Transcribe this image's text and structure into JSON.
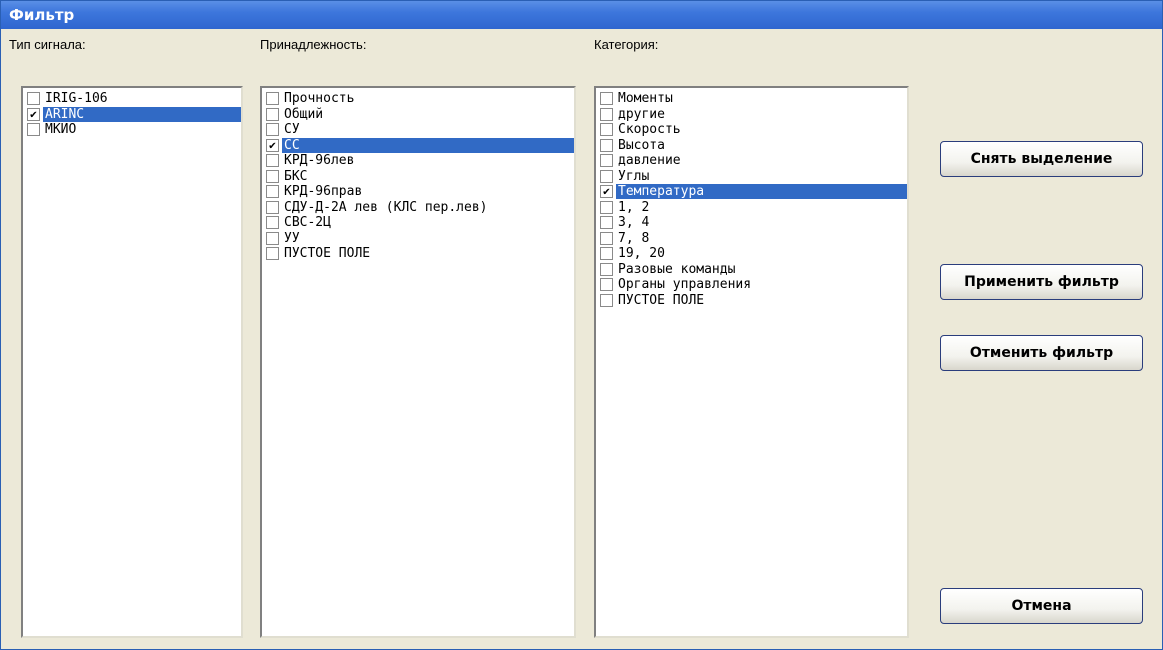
{
  "window": {
    "title": "Фильтр"
  },
  "signal_type": {
    "label": "Тип сигнала:",
    "items": [
      {
        "text": "IRIG-106",
        "checked": false,
        "selected": false
      },
      {
        "text": "ARINC",
        "checked": true,
        "selected": true
      },
      {
        "text": "МКИО",
        "checked": false,
        "selected": false
      }
    ]
  },
  "affiliation": {
    "label": "Принадлежность:",
    "items": [
      {
        "text": "Прочность",
        "checked": false,
        "selected": false
      },
      {
        "text": "Общий",
        "checked": false,
        "selected": false
      },
      {
        "text": "СУ",
        "checked": false,
        "selected": false
      },
      {
        "text": "СС",
        "checked": true,
        "selected": true
      },
      {
        "text": "КРД-96лев",
        "checked": false,
        "selected": false
      },
      {
        "text": "БКС",
        "checked": false,
        "selected": false
      },
      {
        "text": "КРД-96прав",
        "checked": false,
        "selected": false
      },
      {
        "text": "СДУ-Д-2А лев (КЛС пер.лев)",
        "checked": false,
        "selected": false
      },
      {
        "text": "СВС-2Ц",
        "checked": false,
        "selected": false
      },
      {
        "text": "УУ",
        "checked": false,
        "selected": false
      },
      {
        "text": "ПУСТОЕ ПОЛЕ",
        "checked": false,
        "selected": false
      }
    ]
  },
  "category": {
    "label": "Категория:",
    "items": [
      {
        "text": "Моменты",
        "checked": false,
        "selected": false
      },
      {
        "text": "другие",
        "checked": false,
        "selected": false
      },
      {
        "text": "Скорость",
        "checked": false,
        "selected": false
      },
      {
        "text": "Высота",
        "checked": false,
        "selected": false
      },
      {
        "text": "давление",
        "checked": false,
        "selected": false
      },
      {
        "text": "Углы",
        "checked": false,
        "selected": false
      },
      {
        "text": "Температура",
        "checked": true,
        "selected": true
      },
      {
        "text": "1, 2",
        "checked": false,
        "selected": false
      },
      {
        "text": "3, 4",
        "checked": false,
        "selected": false
      },
      {
        "text": "7, 8",
        "checked": false,
        "selected": false
      },
      {
        "text": "19, 20",
        "checked": false,
        "selected": false
      },
      {
        "text": "Разовые команды",
        "checked": false,
        "selected": false
      },
      {
        "text": "Органы управления",
        "checked": false,
        "selected": false
      },
      {
        "text": "ПУСТОЕ ПОЛЕ",
        "checked": false,
        "selected": false
      }
    ]
  },
  "buttons": {
    "clear_selection": "Снять выделение",
    "apply_filter": "Применить фильтр",
    "cancel_filter": "Отменить фильтр",
    "cancel": "Отмена"
  },
  "colors": {
    "selection": "#316ac5",
    "titlebar": "#3d76dc",
    "window_bg": "#ece9d8"
  }
}
